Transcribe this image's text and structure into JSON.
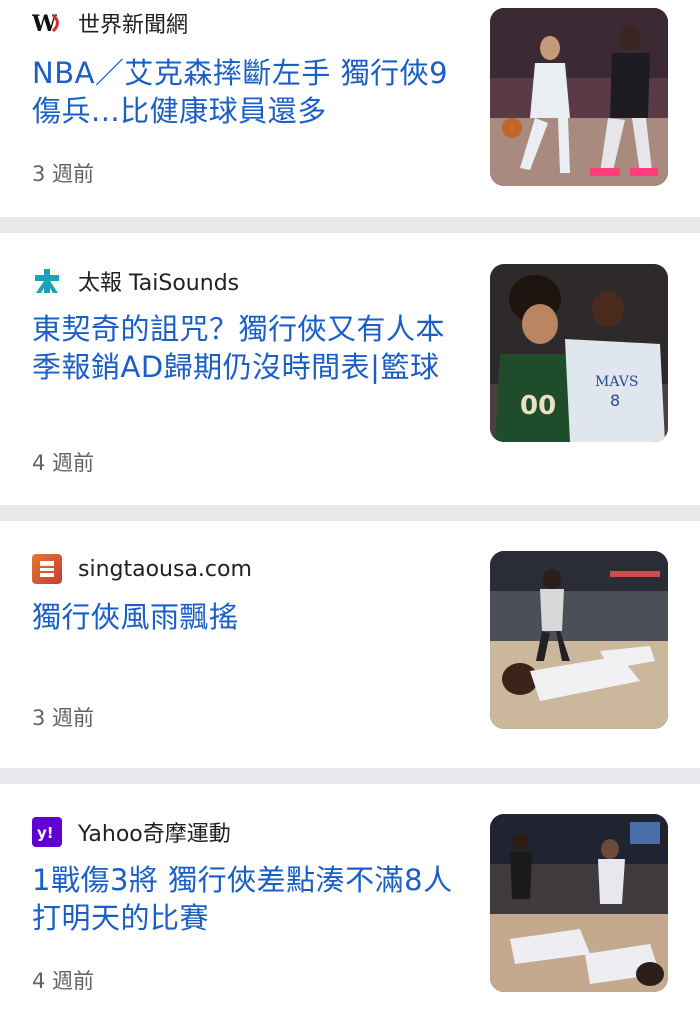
{
  "articles": [
    {
      "source": "世界新聞網",
      "headline": "NBA／艾克森摔斷左手 獨行俠9傷兵...比健康球員還多",
      "age": "3 週前",
      "icon": "world-journal-logo-icon",
      "image": "basketball-dribble-photo"
    },
    {
      "source": "太報 TaiSounds",
      "headline": "東契奇的詛咒？獨行俠又有人本季報銷AD歸期仍沒時間表|籃球",
      "age": "4 週前",
      "icon": "taisounds-logo-icon",
      "image": "mavs-vs-bucks-photo"
    },
    {
      "source": "singtaousa.com",
      "headline": "獨行俠風雨飄搖",
      "age": "3 週前",
      "icon": "singtao-logo-icon",
      "image": "player-on-floor-photo"
    },
    {
      "source": "Yahoo奇摩運動",
      "headline": "1戰傷3將 獨行俠差點湊不滿8人打明天的比賽",
      "age": "4 週前",
      "icon": "yahoo-logo-icon",
      "image": "players-down-photo"
    }
  ],
  "colors": {
    "headline": "#1a5fc8",
    "divider": "#e8eaed",
    "yahoo": "#6001d2",
    "taisounds": "#19a3b8"
  }
}
